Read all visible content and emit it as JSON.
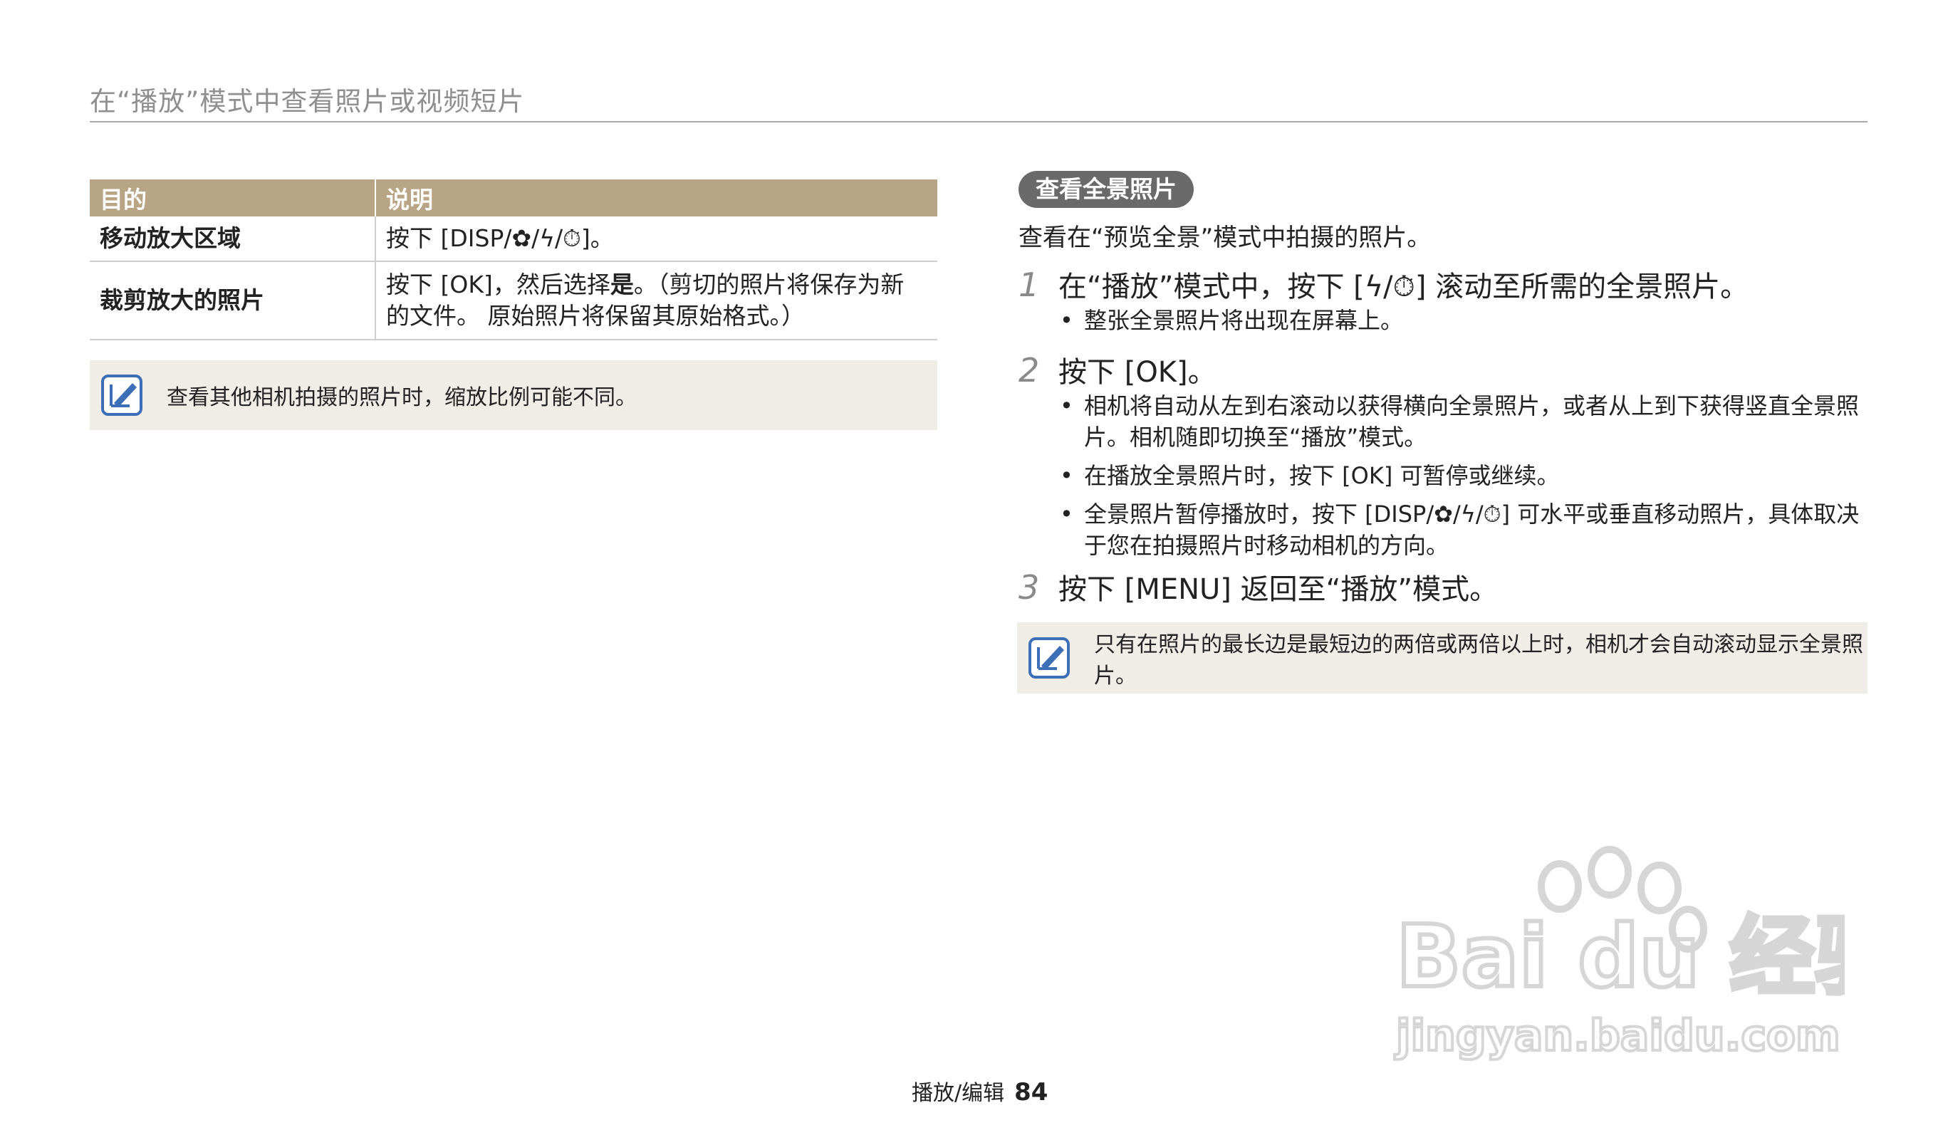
{
  "header": {
    "title": "在“播放”模式中查看照片或视频短片"
  },
  "table": {
    "col1": "目的",
    "col2": "说明",
    "rows": [
      {
        "purpose": "移动放大区域",
        "desc": "按下 [DISP/✿/ϟ/⏱]。"
      },
      {
        "purpose": "裁剪放大的照片",
        "desc_a": "按下 [OK]，然后选择",
        "desc_bold": "是",
        "desc_b": "。（剪切的照片将保存为新的文件。 原始照片将保留其原始格式。）"
      }
    ]
  },
  "note_left": "查看其他相机拍摄的照片时，缩放比例可能不同。",
  "section": {
    "badge": "查看全景照片",
    "intro": "查看在“预览全景”模式中拍摄的照片。",
    "steps": [
      {
        "num": "1",
        "text": "在“播放”模式中，按下 [ϟ/⏱] 滚动至所需的全景照片。",
        "bullets": [
          "整张全景照片将出现在屏幕上。"
        ]
      },
      {
        "num": "2",
        "text": "按下 [OK]。",
        "bullets": [
          "相机将自动从左到右滚动以获得横向全景照片，或者从上到下获得竖直全景照片。相机随即切换至“播放”模式。",
          "在播放全景照片时，按下 [OK] 可暂停或继续。",
          "全景照片暂停播放时，按下 [DISP/✿/ϟ/⏱] 可水平或垂直移动照片，具体取决于您在拍摄照片时移动相机的方向。"
        ]
      },
      {
        "num": "3",
        "text": "按下 [MENU] 返回至“播放”模式。"
      }
    ]
  },
  "note_right": "只有在照片的最长边是最短边的两倍或两倍以上时，相机才会自动滚动显示全景照片。",
  "footer": {
    "section": "播放/编辑",
    "page": "84"
  },
  "watermark": {
    "logo": "Bai du 经验",
    "url": "jingyan.baidu.com"
  }
}
